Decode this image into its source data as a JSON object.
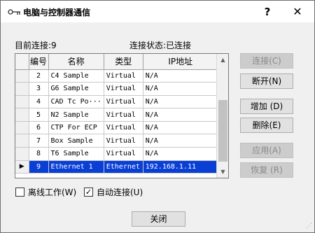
{
  "window": {
    "title": "电脑与控制器通信",
    "help": "?",
    "close": "✕"
  },
  "status": {
    "connected_count": "目前连接:9",
    "connection_state": "连接状态:已连接"
  },
  "table": {
    "columns": [
      "编号",
      "名称",
      "类型",
      "IP地址"
    ],
    "rows": [
      {
        "num": "2",
        "name": "C4 Sample",
        "type": "Virtual",
        "ip": "N/A"
      },
      {
        "num": "3",
        "name": "G6 Sample",
        "type": "Virtual",
        "ip": "N/A"
      },
      {
        "num": "4",
        "name": "CAD Tc Po···",
        "type": "Virtual",
        "ip": "N/A"
      },
      {
        "num": "5",
        "name": "N2 Sample",
        "type": "Virtual",
        "ip": "N/A"
      },
      {
        "num": "6",
        "name": "CTP For ECP",
        "type": "Virtual",
        "ip": "N/A"
      },
      {
        "num": "7",
        "name": "Box Sample",
        "type": "Virtual",
        "ip": "N/A"
      },
      {
        "num": "8",
        "name": "T6 Sample",
        "type": "Virtual",
        "ip": "N/A"
      },
      {
        "num": "9",
        "name": "Ethernet 1",
        "type": "Ethernet",
        "ip": "192.168.1.11"
      }
    ],
    "selected_row_marker": "▶"
  },
  "buttons": {
    "connect": "连接(C)",
    "disconnect": "断开(N)",
    "add": "增加 (D)",
    "delete": "删除(E)",
    "apply": "应用(A)",
    "restore": "恢复 (R)",
    "close": "关闭"
  },
  "checkboxes": {
    "offline": {
      "label": "离线工作(W)",
      "checked": false
    },
    "auto_connect": {
      "label": "自动连接(U)",
      "checked": true
    }
  }
}
